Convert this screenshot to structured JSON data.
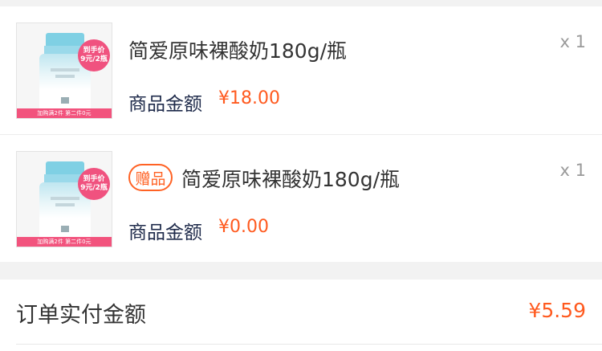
{
  "items": [
    {
      "title": "简爱原味裸酸奶180g/瓶",
      "quantity": "x 1",
      "amount_label": "商品金额",
      "amount_value": "¥18.00",
      "gift": false,
      "badge_line1": "到手价",
      "badge_line2": "9元/2瓶",
      "banner": "加购满2件 第二件0元"
    },
    {
      "title": "简爱原味裸酸奶180g/瓶",
      "quantity": "x 1",
      "amount_label": "商品金额",
      "amount_value": "¥0.00",
      "gift": true,
      "gift_tag": "赠品",
      "badge_line1": "到手价",
      "badge_line2": "9元/2瓶",
      "banner": "加购满2件 第二件0元"
    }
  ],
  "total": {
    "label": "订单实付金额",
    "value": "¥5.59"
  },
  "colors": {
    "accent_orange": "#ff5a1f",
    "badge_pink": "#f0527f",
    "label_navy": "#1e2a4a"
  }
}
